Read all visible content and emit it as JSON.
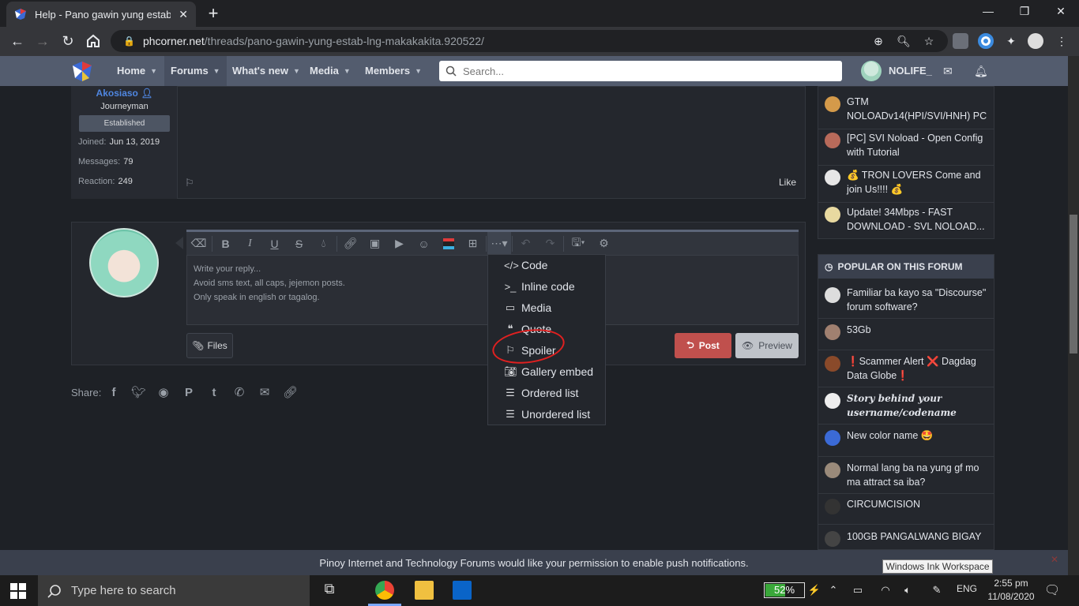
{
  "browser": {
    "tab_title": "Help - Pano gawin yung estab lng",
    "url_host": "phcorner.net",
    "url_path": "/threads/pano-gawin-yung-estab-lng-makakakita.920522/",
    "new_tab": "+",
    "close_tab": "✕"
  },
  "nav": {
    "items": [
      "Home",
      "Forums",
      "What's new",
      "Media",
      "Members"
    ],
    "search_placeholder": "Search...",
    "username": "NOLIFE_"
  },
  "post": {
    "username": "Akosiaso",
    "title": "Journeyman",
    "badge": "Established",
    "joined_label": "Joined:",
    "joined_value": "Jun 13, 2019",
    "messages_label": "Messages:",
    "messages_value": "79",
    "reaction_label": "Reaction:",
    "reaction_value": "249",
    "like": "Like"
  },
  "editor": {
    "placeholder_lines": [
      "Write your reply...",
      "Avoid sms text, all caps, jejemon posts.",
      "Only speak in english or tagalog."
    ],
    "files": "Files",
    "post": "Post",
    "preview": "Preview"
  },
  "dropdown": {
    "items": [
      {
        "label": "Code",
        "icon": "code-icon"
      },
      {
        "label": "Inline code",
        "icon": "terminal-icon"
      },
      {
        "label": "Media",
        "icon": "video-icon"
      },
      {
        "label": "Quote",
        "icon": "quote-icon"
      },
      {
        "label": "Spoiler",
        "icon": "flag-icon"
      },
      {
        "label": "Gallery embed",
        "icon": "camera-icon"
      },
      {
        "label": "Ordered list",
        "icon": "ordered-list-icon"
      },
      {
        "label": "Unordered list",
        "icon": "unordered-list-icon"
      }
    ],
    "highlight_color": "#e02020"
  },
  "share": {
    "label": "Share:"
  },
  "sidebar": {
    "top_items": [
      "GTM NOLOADv14(HPI/SVI/HNH) PC",
      "[PC] SVI Noload - Open Config with Tutorial",
      "💰 TRON LOVERS Come and join Us!!!! 💰",
      "Update! 34Mbps - FAST DOWNLOAD - SVL NOLOAD..."
    ],
    "popular_title": "POPULAR ON THIS FORUM",
    "popular_items": [
      "Familiar ba kayo sa \"Discourse\" forum software?",
      "53Gb",
      "❗Scammer Alert ❌ Dagdag Data Globe❗",
      "Story behind your username/codename",
      "New color name 🤩",
      "Normal lang ba na yung gf mo ma attract sa iba?",
      "CIRCUMCISION",
      "100GB PANGALWANG BIGAY"
    ]
  },
  "notification": {
    "text": "Pinoy Internet and Technology Forums would like your permission to enable push notifications.",
    "tooltip": "Windows Ink Workspace"
  },
  "taskbar": {
    "search_placeholder": "Type here to search",
    "battery": "52%",
    "battery_level": 0.52,
    "lang": "ENG",
    "time": "2:55 pm",
    "date": "11/08/2020"
  },
  "colors": {
    "accent_link": "#4f86e0",
    "post_button": "#c0504d",
    "nav_bg": "#535c6e"
  }
}
